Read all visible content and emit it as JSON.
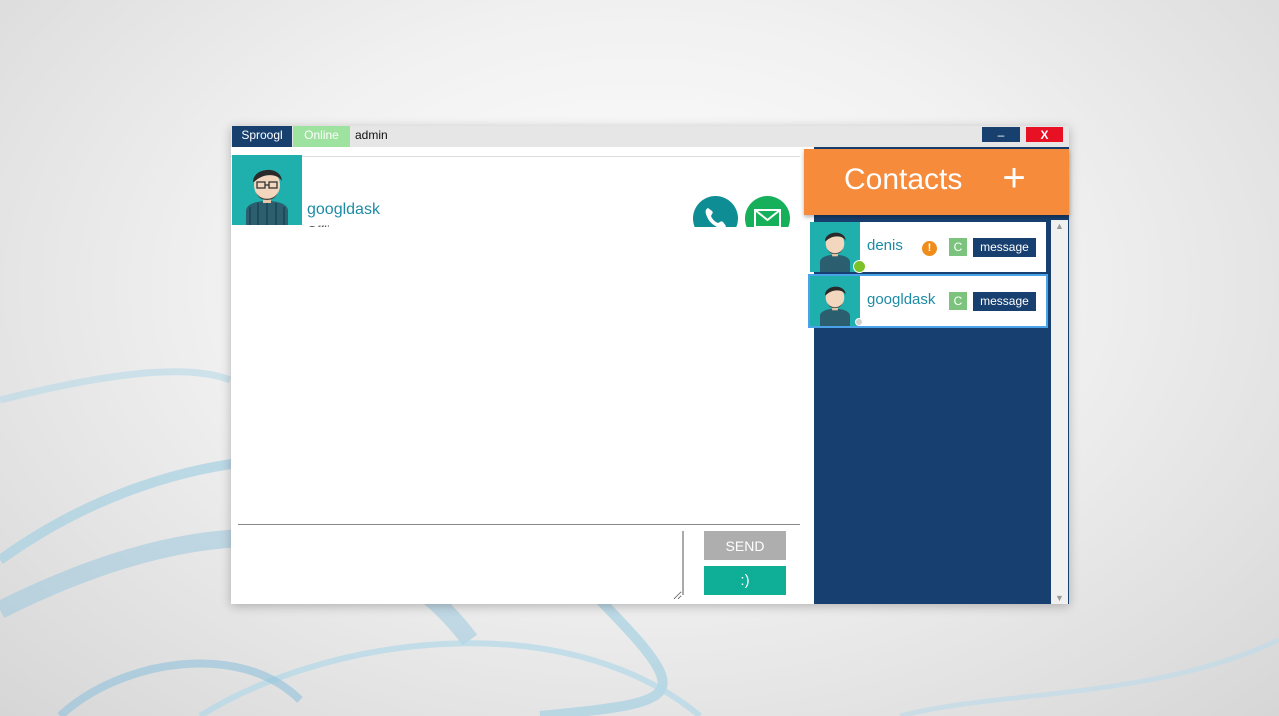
{
  "titlebar": {
    "app_name": "Sproogl",
    "status": "Online",
    "username": "admin",
    "minimize_label": "–",
    "close_label": "X"
  },
  "chat": {
    "contact_name": "googldask",
    "contact_status": "Offline",
    "compose_placeholder": "",
    "send_label": "SEND",
    "emoji_label": ":)"
  },
  "contacts": {
    "title": "Contacts",
    "add_label": "+",
    "items": [
      {
        "name": "denis",
        "presence": "online",
        "alert": "!",
        "badge": "C",
        "message_label": "message"
      },
      {
        "name": "googldask",
        "presence": "offline",
        "badge": "C",
        "message_label": "message"
      }
    ]
  },
  "colors": {
    "brand": "#17406f",
    "accent": "#f68b3c",
    "online": "#7bc12a",
    "teal": "#1fb0ad"
  }
}
